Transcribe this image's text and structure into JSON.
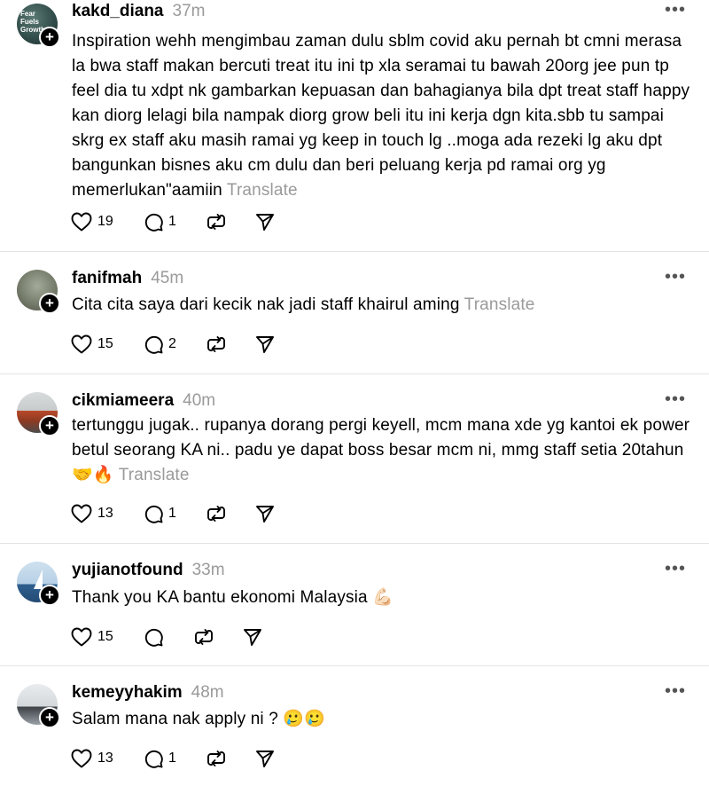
{
  "translate_label": "Translate",
  "posts": [
    {
      "username": "kakd_diana",
      "time": "37m",
      "text": "Inspiration wehh mengimbau zaman dulu sblm covid aku pernah bt cmni merasa la bwa staff makan bercuti treat itu ini tp xla seramai tu bawah 20org jee pun tp feel dia tu xdpt nk gambarkan kepuasan dan bahagianya bila dpt treat staff happy kan diorg lelagi bila nampak diorg grow beli itu ini kerja dgn kita.sbb tu sampai skrg ex staff aku masih ramai yg keep in touch lg ..moga ada rezeki lg aku dpt bangunkan bisnes aku cm dulu dan beri peluang kerja pd ramai org yg memerlukan\"aamiin",
      "likes": "19",
      "replies": "1",
      "avatar_text": "Fear Fuels Growth"
    },
    {
      "username": "fanifmah",
      "time": "45m",
      "text": "Cita cita saya dari kecik nak jadi staff khairul aming",
      "likes": "15",
      "replies": "2"
    },
    {
      "username": "cikmiameera",
      "time": "40m",
      "text": "tertunggu jugak.. rupanya dorang pergi keyell, mcm mana xde yg kantoi ek power betul seorang KA ni.. padu ye dapat boss besar mcm ni, mmg staff setia 20tahun🤝🔥",
      "likes": "13",
      "replies": "1"
    },
    {
      "username": "yujianotfound",
      "time": "33m",
      "text": "Thank you KA bantu ekonomi Malaysia 💪🏻",
      "likes": "15",
      "replies": ""
    },
    {
      "username": "kemeyyhakim",
      "time": "48m",
      "text": "Salam mana nak apply ni ? 🥲🥲",
      "likes": "13",
      "replies": "1"
    }
  ]
}
